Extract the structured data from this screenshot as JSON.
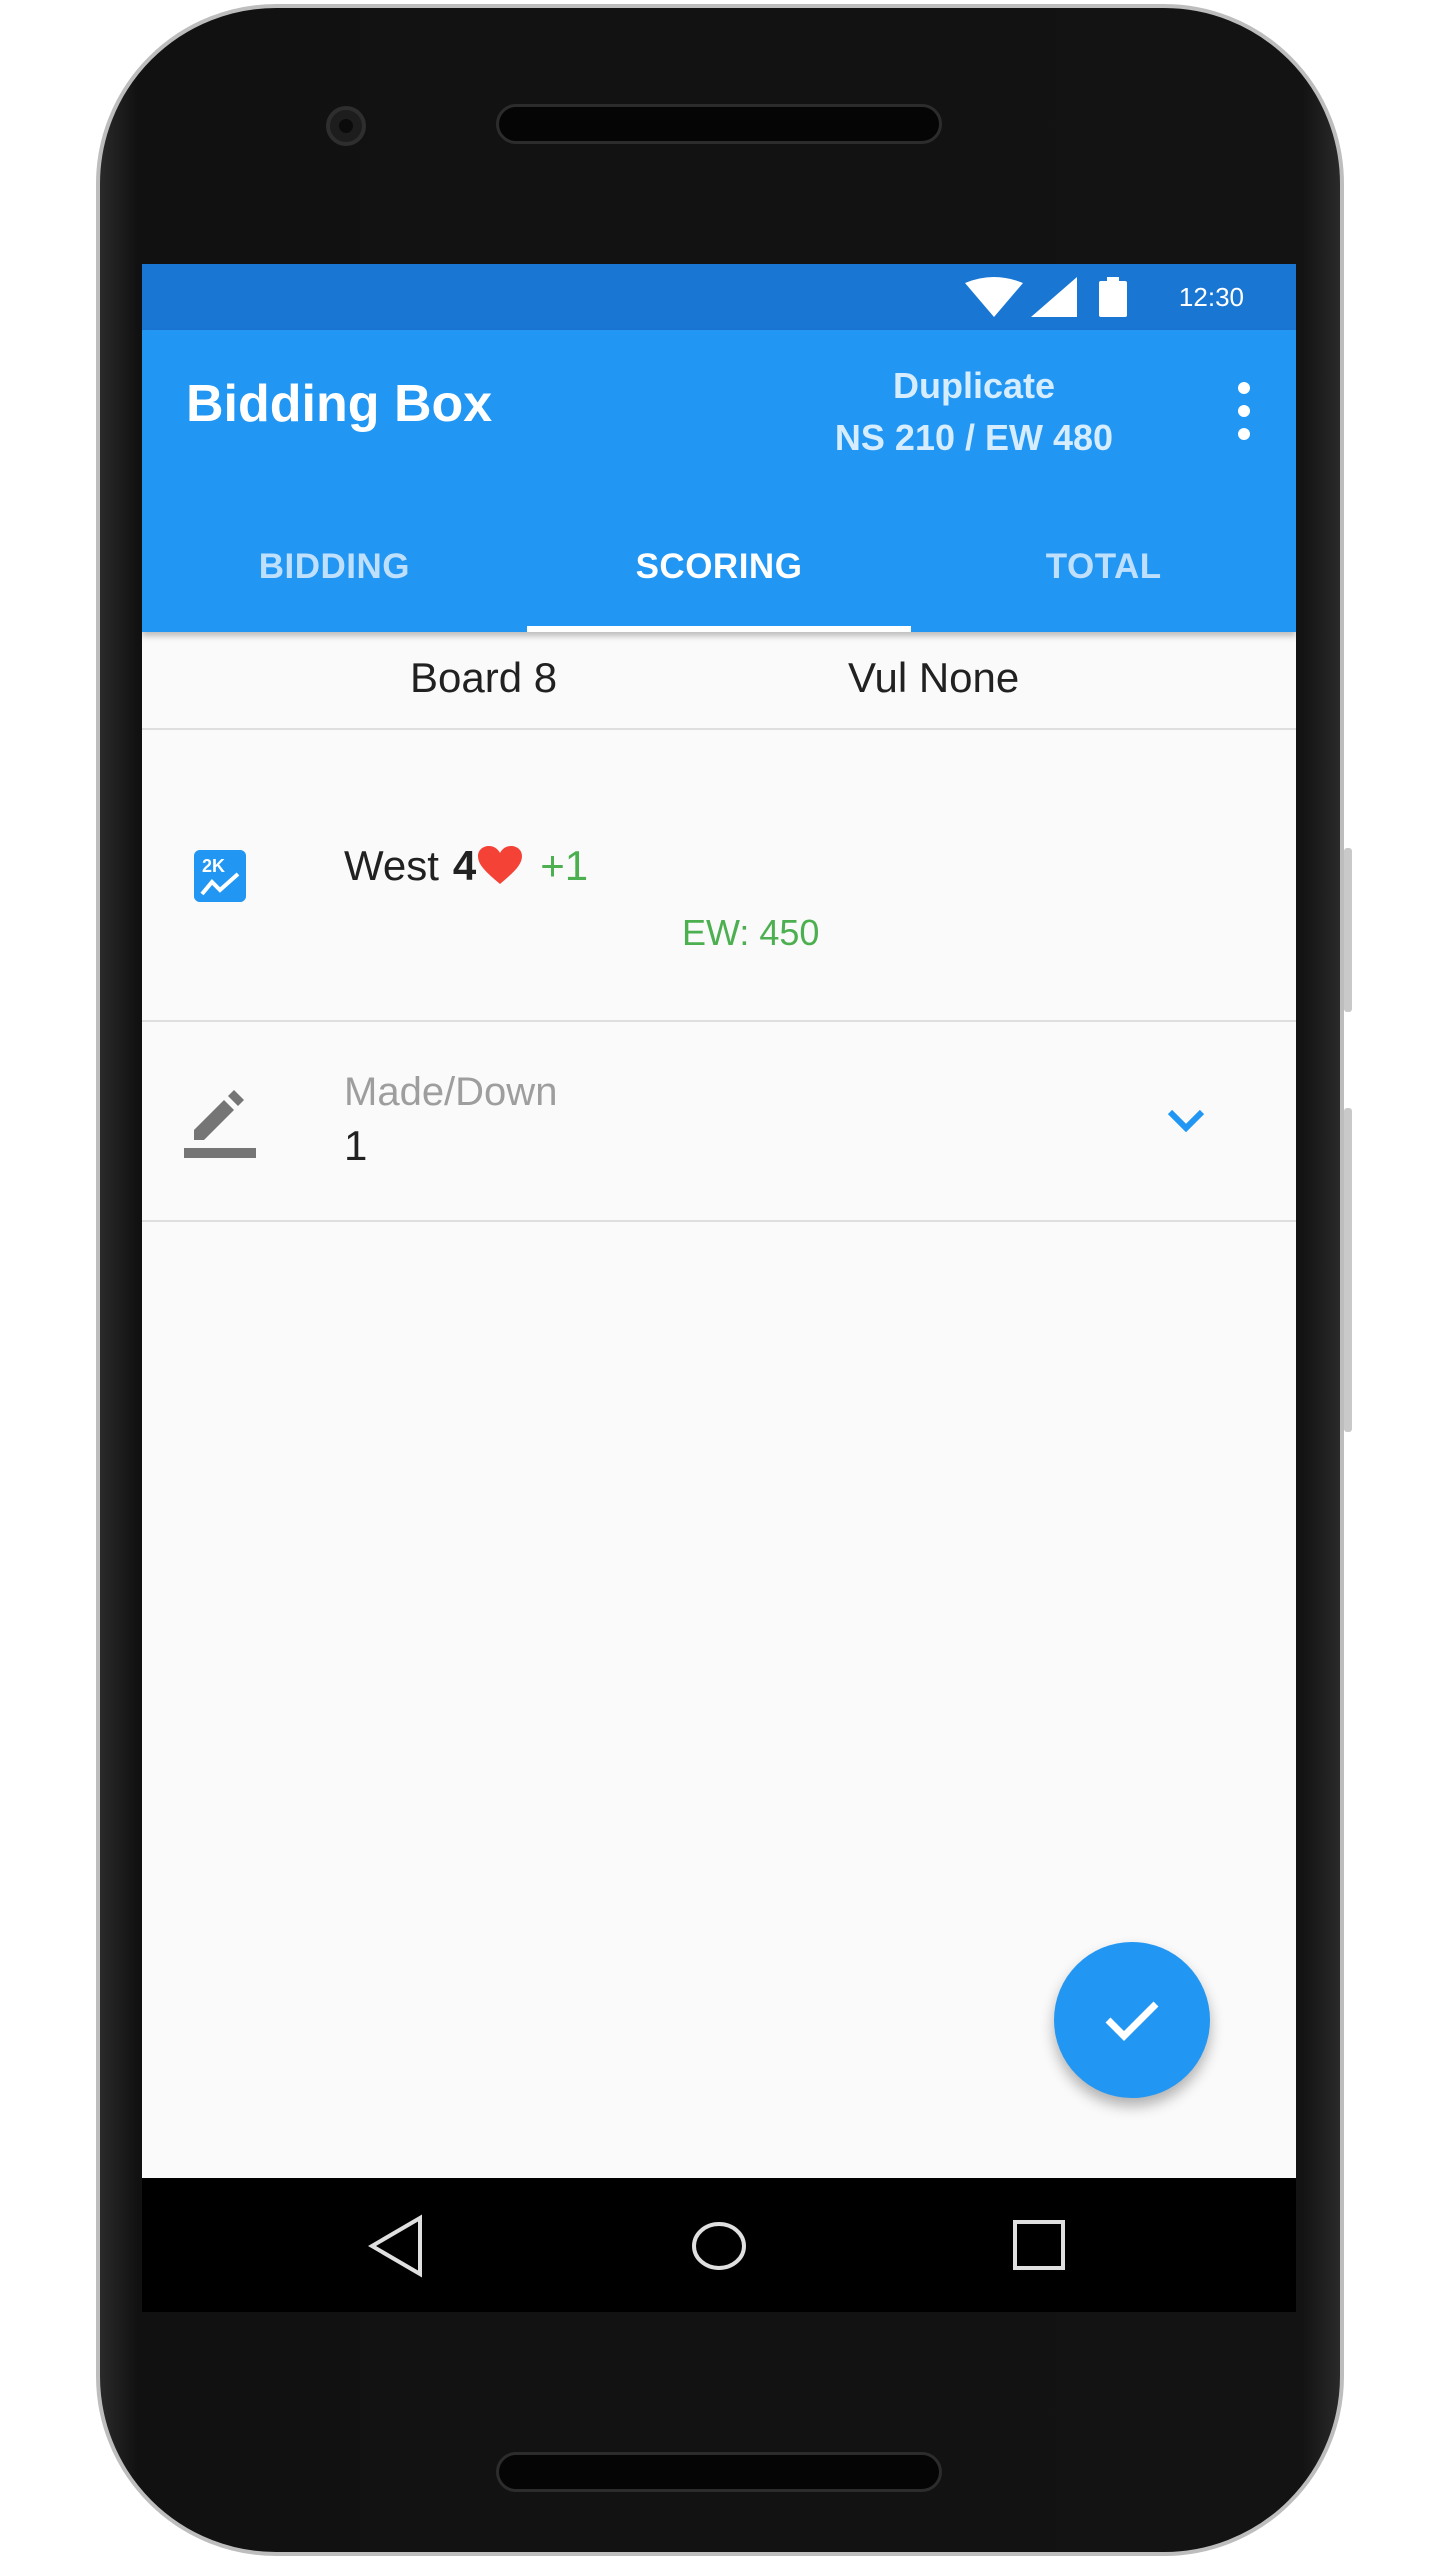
{
  "status_bar": {
    "time": "12:30",
    "icons": [
      "wifi-icon",
      "signal-icon",
      "battery-icon"
    ]
  },
  "app_bar": {
    "title": "Bidding Box",
    "mode": "Duplicate",
    "scores": "NS 210 / EW 480",
    "overflow_icon": "more-vert-icon"
  },
  "tabs": [
    {
      "label": "BIDDING",
      "active": false
    },
    {
      "label": "SCORING",
      "active": true
    },
    {
      "label": "TOTAL",
      "active": false
    }
  ],
  "board": {
    "label": "Board 8",
    "vulnerability": "Vul None"
  },
  "contract": {
    "declarer": "West",
    "level": "4",
    "suit": "heart",
    "overtricks": "+1",
    "result": "EW: 450",
    "icon": "score-chart-icon"
  },
  "made_down": {
    "label": "Made/Down",
    "value": "1",
    "icon": "edit-icon",
    "dropdown_icon": "chevron-down-icon"
  },
  "fab": {
    "icon": "check-icon"
  },
  "colors": {
    "primary": "#2196f3",
    "primary_dark": "#1976d2",
    "positive": "#4caf50",
    "heart": "#f44336"
  },
  "nav": [
    "back-icon",
    "home-icon",
    "recents-icon"
  ]
}
